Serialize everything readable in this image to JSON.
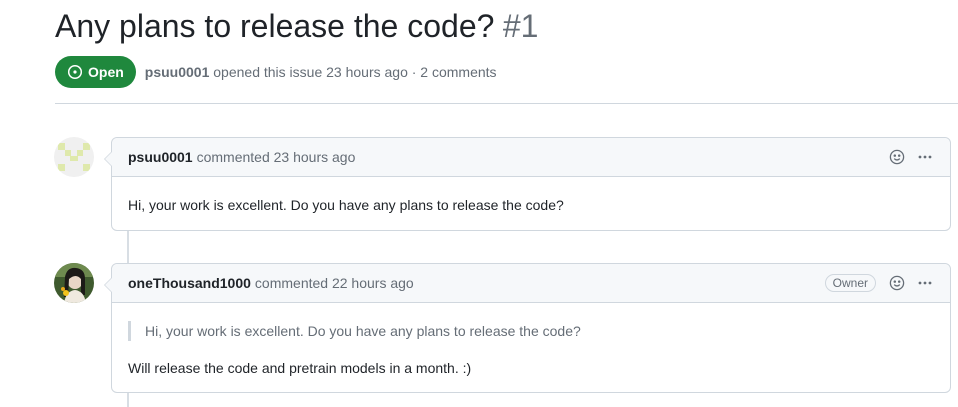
{
  "issue": {
    "title": "Any plans to release the code?",
    "number": "#1",
    "state": "Open",
    "author": "psuu0001",
    "meta_text": "opened this issue 23 hours ago · 2 comments"
  },
  "comments": [
    {
      "author": "psuu0001",
      "action": "commented 23 hours ago",
      "body": "Hi, your work is excellent. Do you have any plans to release the code?"
    },
    {
      "author": "oneThousand1000",
      "action": "commented 22 hours ago",
      "badge": "Owner",
      "quote": "Hi, your work is excellent. Do you have any plans to release the code?",
      "body": "Will release the code and pretrain models in a month. :)"
    }
  ],
  "colors": {
    "open_green": "#1f883d",
    "border": "#d0d7de",
    "header_bg": "#f6f8fa",
    "muted_text": "#656d76"
  },
  "icons": [
    "issue-opened-icon",
    "smiley-icon",
    "kebab-horizontal-icon"
  ]
}
